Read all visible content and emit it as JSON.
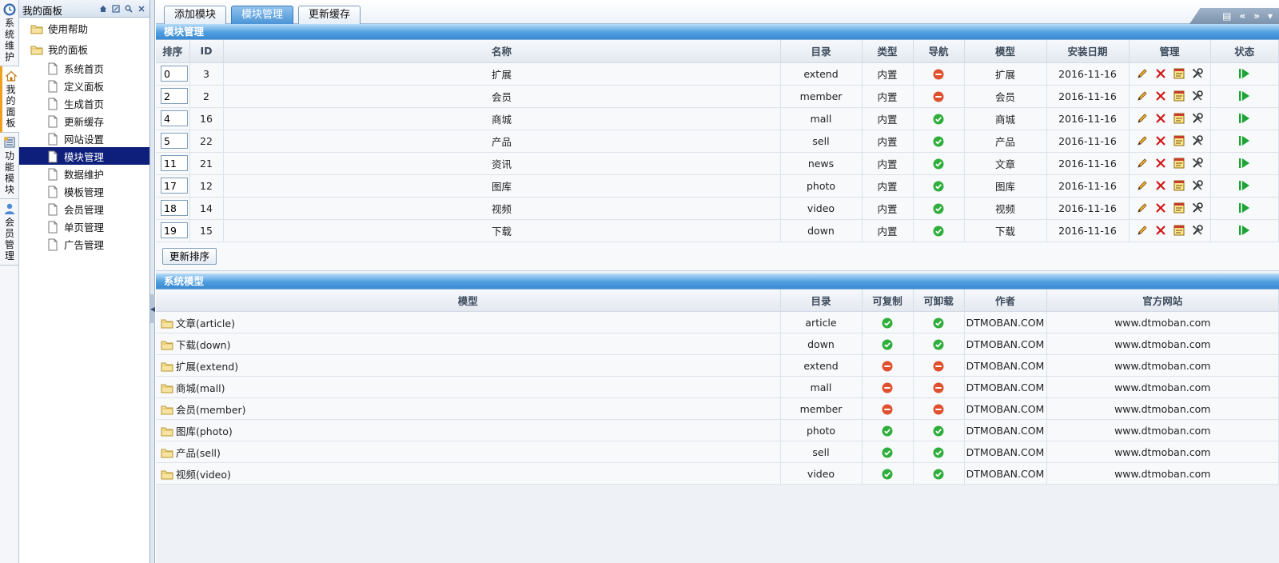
{
  "vtabs": [
    {
      "label": "系统维护",
      "icon": "clock-icon",
      "active": false
    },
    {
      "label": "我的面板",
      "icon": "home-icon",
      "active": true
    },
    {
      "label": "功能模块",
      "icon": "module-icon",
      "active": false
    },
    {
      "label": "会员管理",
      "icon": "user-icon",
      "active": false
    }
  ],
  "tree": {
    "title": "我的面板",
    "tools": [
      "home-icon",
      "restore-icon",
      "search-icon",
      "close-icon"
    ],
    "top_items": [
      "使用帮助",
      "我的面板"
    ],
    "children": [
      "系统首页",
      "定义面板",
      "生成首页",
      "更新缓存",
      "网站设置",
      "模块管理",
      "数据维护",
      "模板管理",
      "会员管理",
      "单页管理",
      "广告管理"
    ],
    "selected": "模块管理"
  },
  "tabs": [
    {
      "label": "添加模块",
      "active": false
    },
    {
      "label": "模块管理",
      "active": true
    },
    {
      "label": "更新缓存",
      "active": false
    }
  ],
  "nav": {
    "item1": "▤",
    "prev": "«",
    "next": "»",
    "dropdown": "▾"
  },
  "modules": {
    "title": "模块管理",
    "headers": [
      "排序",
      "ID",
      "名称",
      "目录",
      "类型",
      "导航",
      "模型",
      "安装日期",
      "管理",
      "状态"
    ],
    "rows": [
      {
        "order": "0",
        "id": "3",
        "name": "扩展",
        "dir": "extend",
        "type": "内置",
        "nav": false,
        "model": "扩展",
        "date": "2016-11-16"
      },
      {
        "order": "2",
        "id": "2",
        "name": "会员",
        "dir": "member",
        "type": "内置",
        "nav": false,
        "model": "会员",
        "date": "2016-11-16"
      },
      {
        "order": "4",
        "id": "16",
        "name": "商城",
        "dir": "mall",
        "type": "内置",
        "nav": true,
        "model": "商城",
        "date": "2016-11-16"
      },
      {
        "order": "5",
        "id": "22",
        "name": "产品",
        "dir": "sell",
        "type": "内置",
        "nav": true,
        "model": "产品",
        "date": "2016-11-16"
      },
      {
        "order": "11",
        "id": "21",
        "name": "资讯",
        "dir": "news",
        "type": "内置",
        "nav": true,
        "model": "文章",
        "date": "2016-11-16"
      },
      {
        "order": "17",
        "id": "12",
        "name": "图库",
        "dir": "photo",
        "type": "内置",
        "nav": true,
        "model": "图库",
        "date": "2016-11-16"
      },
      {
        "order": "18",
        "id": "14",
        "name": "视频",
        "dir": "video",
        "type": "内置",
        "nav": true,
        "model": "视频",
        "date": "2016-11-16"
      },
      {
        "order": "19",
        "id": "15",
        "name": "下载",
        "dir": "down",
        "type": "内置",
        "nav": true,
        "model": "下载",
        "date": "2016-11-16"
      }
    ],
    "update_button": "更新排序"
  },
  "models": {
    "title": "系统模型",
    "headers": [
      "模型",
      "目录",
      "可复制",
      "可卸载",
      "作者",
      "官方网站"
    ],
    "rows": [
      {
        "name": "文章(article)",
        "dir": "article",
        "copy": true,
        "uninstall": true,
        "author": "DTMOBAN.COM",
        "site": "www.dtmoban.com"
      },
      {
        "name": "下载(down)",
        "dir": "down",
        "copy": true,
        "uninstall": true,
        "author": "DTMOBAN.COM",
        "site": "www.dtmoban.com"
      },
      {
        "name": "扩展(extend)",
        "dir": "extend",
        "copy": false,
        "uninstall": false,
        "author": "DTMOBAN.COM",
        "site": "www.dtmoban.com"
      },
      {
        "name": "商城(mall)",
        "dir": "mall",
        "copy": false,
        "uninstall": false,
        "author": "DTMOBAN.COM",
        "site": "www.dtmoban.com"
      },
      {
        "name": "会员(member)",
        "dir": "member",
        "copy": false,
        "uninstall": false,
        "author": "DTMOBAN.COM",
        "site": "www.dtmoban.com"
      },
      {
        "name": "图库(photo)",
        "dir": "photo",
        "copy": true,
        "uninstall": true,
        "author": "DTMOBAN.COM",
        "site": "www.dtmoban.com"
      },
      {
        "name": "产品(sell)",
        "dir": "sell",
        "copy": true,
        "uninstall": true,
        "author": "DTMOBAN.COM",
        "site": "www.dtmoban.com"
      },
      {
        "name": "视频(video)",
        "dir": "video",
        "copy": true,
        "uninstall": true,
        "author": "DTMOBAN.COM",
        "site": "www.dtmoban.com"
      }
    ]
  },
  "colors": {
    "ok": "#2fae3c",
    "no": "#e0502c",
    "selected": "#0d1f7a",
    "accent": "#4b94d6",
    "play": "#1ea336"
  }
}
